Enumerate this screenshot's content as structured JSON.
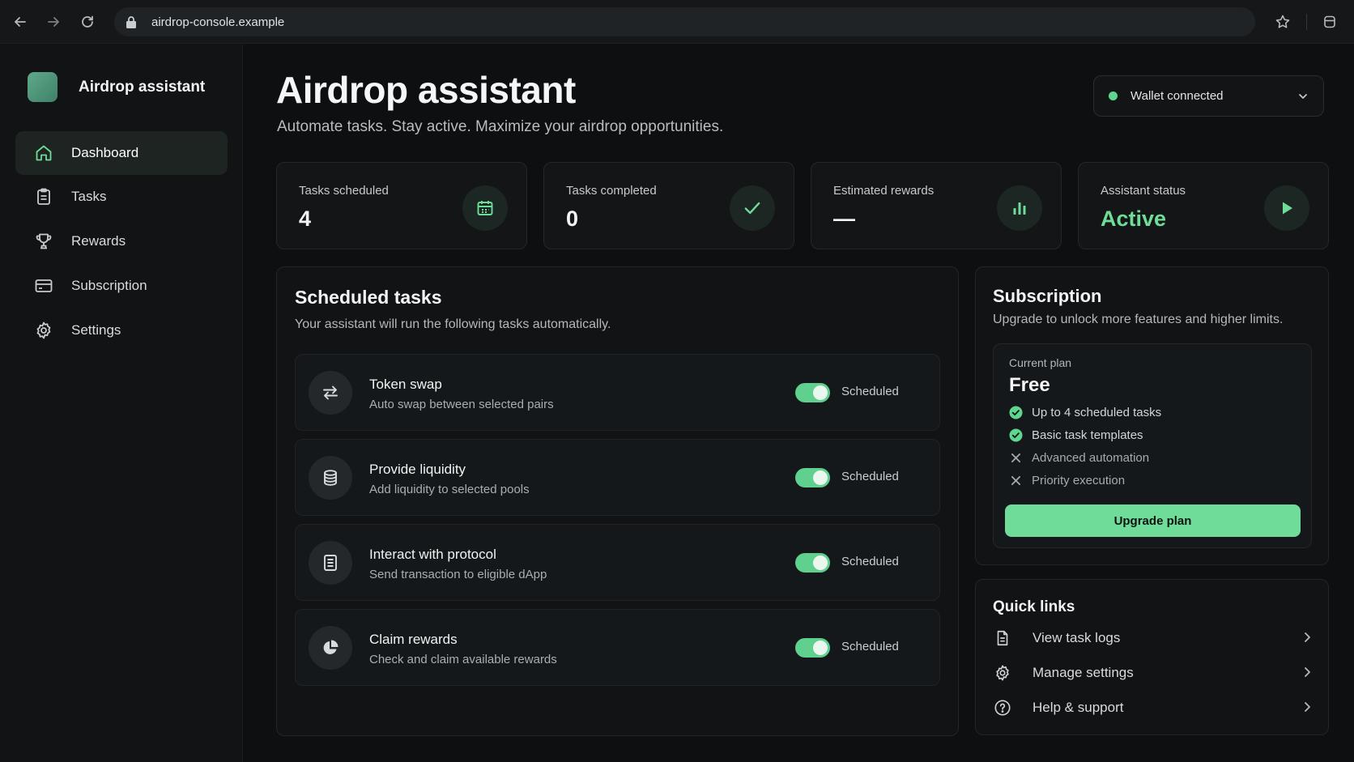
{
  "browser": {
    "url": "airdrop-console.example"
  },
  "sidebar": {
    "brand": "Airdrop assistant",
    "items": [
      {
        "label": "Dashboard",
        "icon": "home-icon",
        "active": true
      },
      {
        "label": "Tasks",
        "icon": "clipboard-icon",
        "active": false
      },
      {
        "label": "Rewards",
        "icon": "trophy-icon",
        "active": false
      },
      {
        "label": "Subscription",
        "icon": "credit-card-icon",
        "active": false
      },
      {
        "label": "Settings",
        "icon": "gear-icon",
        "active": false
      }
    ]
  },
  "header": {
    "title": "Airdrop assistant",
    "subtitle": "Automate tasks. Stay active. Maximize your airdrop opportunities.",
    "wallet_status": "Wallet connected"
  },
  "stats": [
    {
      "label": "Tasks scheduled",
      "value": "4",
      "icon": "calendar-icon"
    },
    {
      "label": "Tasks completed",
      "value": "0",
      "icon": "check-icon"
    },
    {
      "label": "Estimated rewards",
      "value": "—",
      "icon": "bar-chart-icon"
    },
    {
      "label": "Assistant status",
      "value": "Active",
      "icon": "play-icon"
    }
  ],
  "scheduled": {
    "title": "Scheduled tasks",
    "subtitle": "Your assistant will run the following tasks automatically.",
    "tasks": [
      {
        "name": "Token swap",
        "desc": "Auto swap between selected pairs",
        "status": "Scheduled",
        "enabled": true,
        "icon": "swap-icon"
      },
      {
        "name": "Provide liquidity",
        "desc": "Add liquidity to selected pools",
        "status": "Scheduled",
        "enabled": true,
        "icon": "database-icon"
      },
      {
        "name": "Interact with protocol",
        "desc": "Send transaction to eligible dApp",
        "status": "Scheduled",
        "enabled": true,
        "icon": "document-icon"
      },
      {
        "name": "Claim rewards",
        "desc": "Check and claim available rewards",
        "status": "Scheduled",
        "enabled": true,
        "icon": "pie-chart-icon"
      }
    ]
  },
  "subscription": {
    "title": "Subscription",
    "subtitle": "Upgrade to unlock more features and higher limits.",
    "current_label": "Current plan",
    "plan": "Free",
    "features": [
      {
        "text": "Up to 4 scheduled tasks",
        "included": true
      },
      {
        "text": "Basic task templates",
        "included": true
      },
      {
        "text": "Advanced automation",
        "included": false
      },
      {
        "text": "Priority execution",
        "included": false
      }
    ],
    "upgrade_label": "Upgrade plan"
  },
  "quick_links": {
    "title": "Quick links",
    "items": [
      {
        "label": "View task logs",
        "icon": "file-icon"
      },
      {
        "label": "Manage settings",
        "icon": "gear-icon"
      },
      {
        "label": "Help & support",
        "icon": "help-icon"
      }
    ]
  },
  "colors": {
    "accent": "#6fdc9a",
    "background": "#0d0f10",
    "card": "#131517"
  }
}
